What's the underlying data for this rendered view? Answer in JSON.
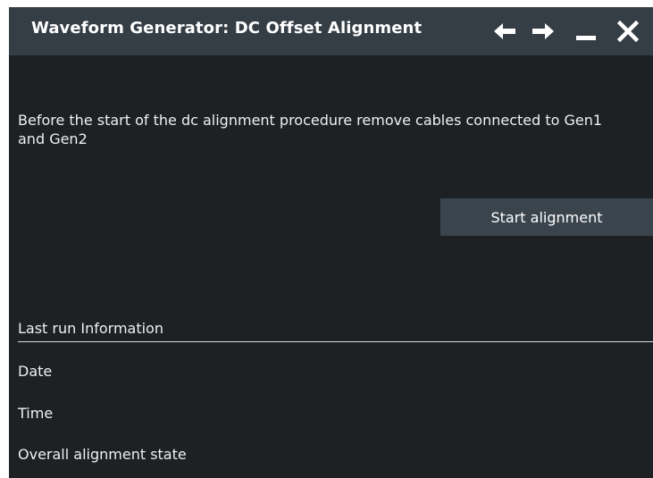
{
  "window": {
    "title": "Waveform Generator: DC Offset Alignment",
    "controls": {
      "back_icon": "arrow-left-icon",
      "forward_icon": "arrow-right-icon",
      "minimize_icon": "minimize-icon",
      "close_icon": "close-icon"
    }
  },
  "main": {
    "instruction": "Before the start of the dc alignment procedure remove cables connected to Gen1\nand Gen2",
    "start_button_label": "Start alignment"
  },
  "last_run": {
    "heading": "Last run Information",
    "fields": {
      "date_label": "Date",
      "time_label": "Time",
      "state_label": "Overall alignment state"
    }
  },
  "colors": {
    "title_bar": "#353d45",
    "background": "#1d2124",
    "button": "#3a444d",
    "text": "#ffffff"
  }
}
